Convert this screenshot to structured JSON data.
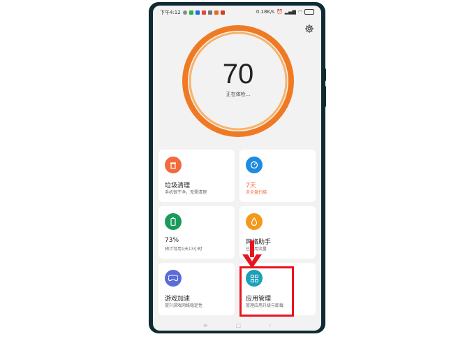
{
  "status_bar": {
    "time": "下午4:12",
    "speed": "0.18K/s"
  },
  "score": {
    "value": "70",
    "label": "正在体检..."
  },
  "cards": [
    {
      "title": "垃圾清理",
      "subtitle": "手机很干净，无需清理",
      "icon": "trash-icon",
      "color": "#f26a3e"
    },
    {
      "title": "7天",
      "subtitle": "未全盘扫描",
      "icon": "timer-icon",
      "color": "#1f8be0",
      "title_color": "#f26a3e"
    },
    {
      "title": "73%",
      "subtitle": "预计可用1天13小时",
      "icon": "battery-icon",
      "color": "#1a9a5c"
    },
    {
      "title": "网络助手",
      "subtitle": "已使用流量",
      "icon": "water-drop-icon",
      "color": "#f39a1e"
    },
    {
      "title": "游戏加速",
      "subtitle": "提升游戏网络稳定性",
      "icon": "gamepad-icon",
      "color": "#5b6bd8"
    },
    {
      "title": "应用管理",
      "subtitle": "管理应用升级与卸载",
      "icon": "apps-grid-icon",
      "color": "#1aa0b8"
    }
  ],
  "colors": {
    "ring_outer": "#f07a24",
    "ring_inner": "#f8b36a",
    "highlight": "#e8141e"
  }
}
